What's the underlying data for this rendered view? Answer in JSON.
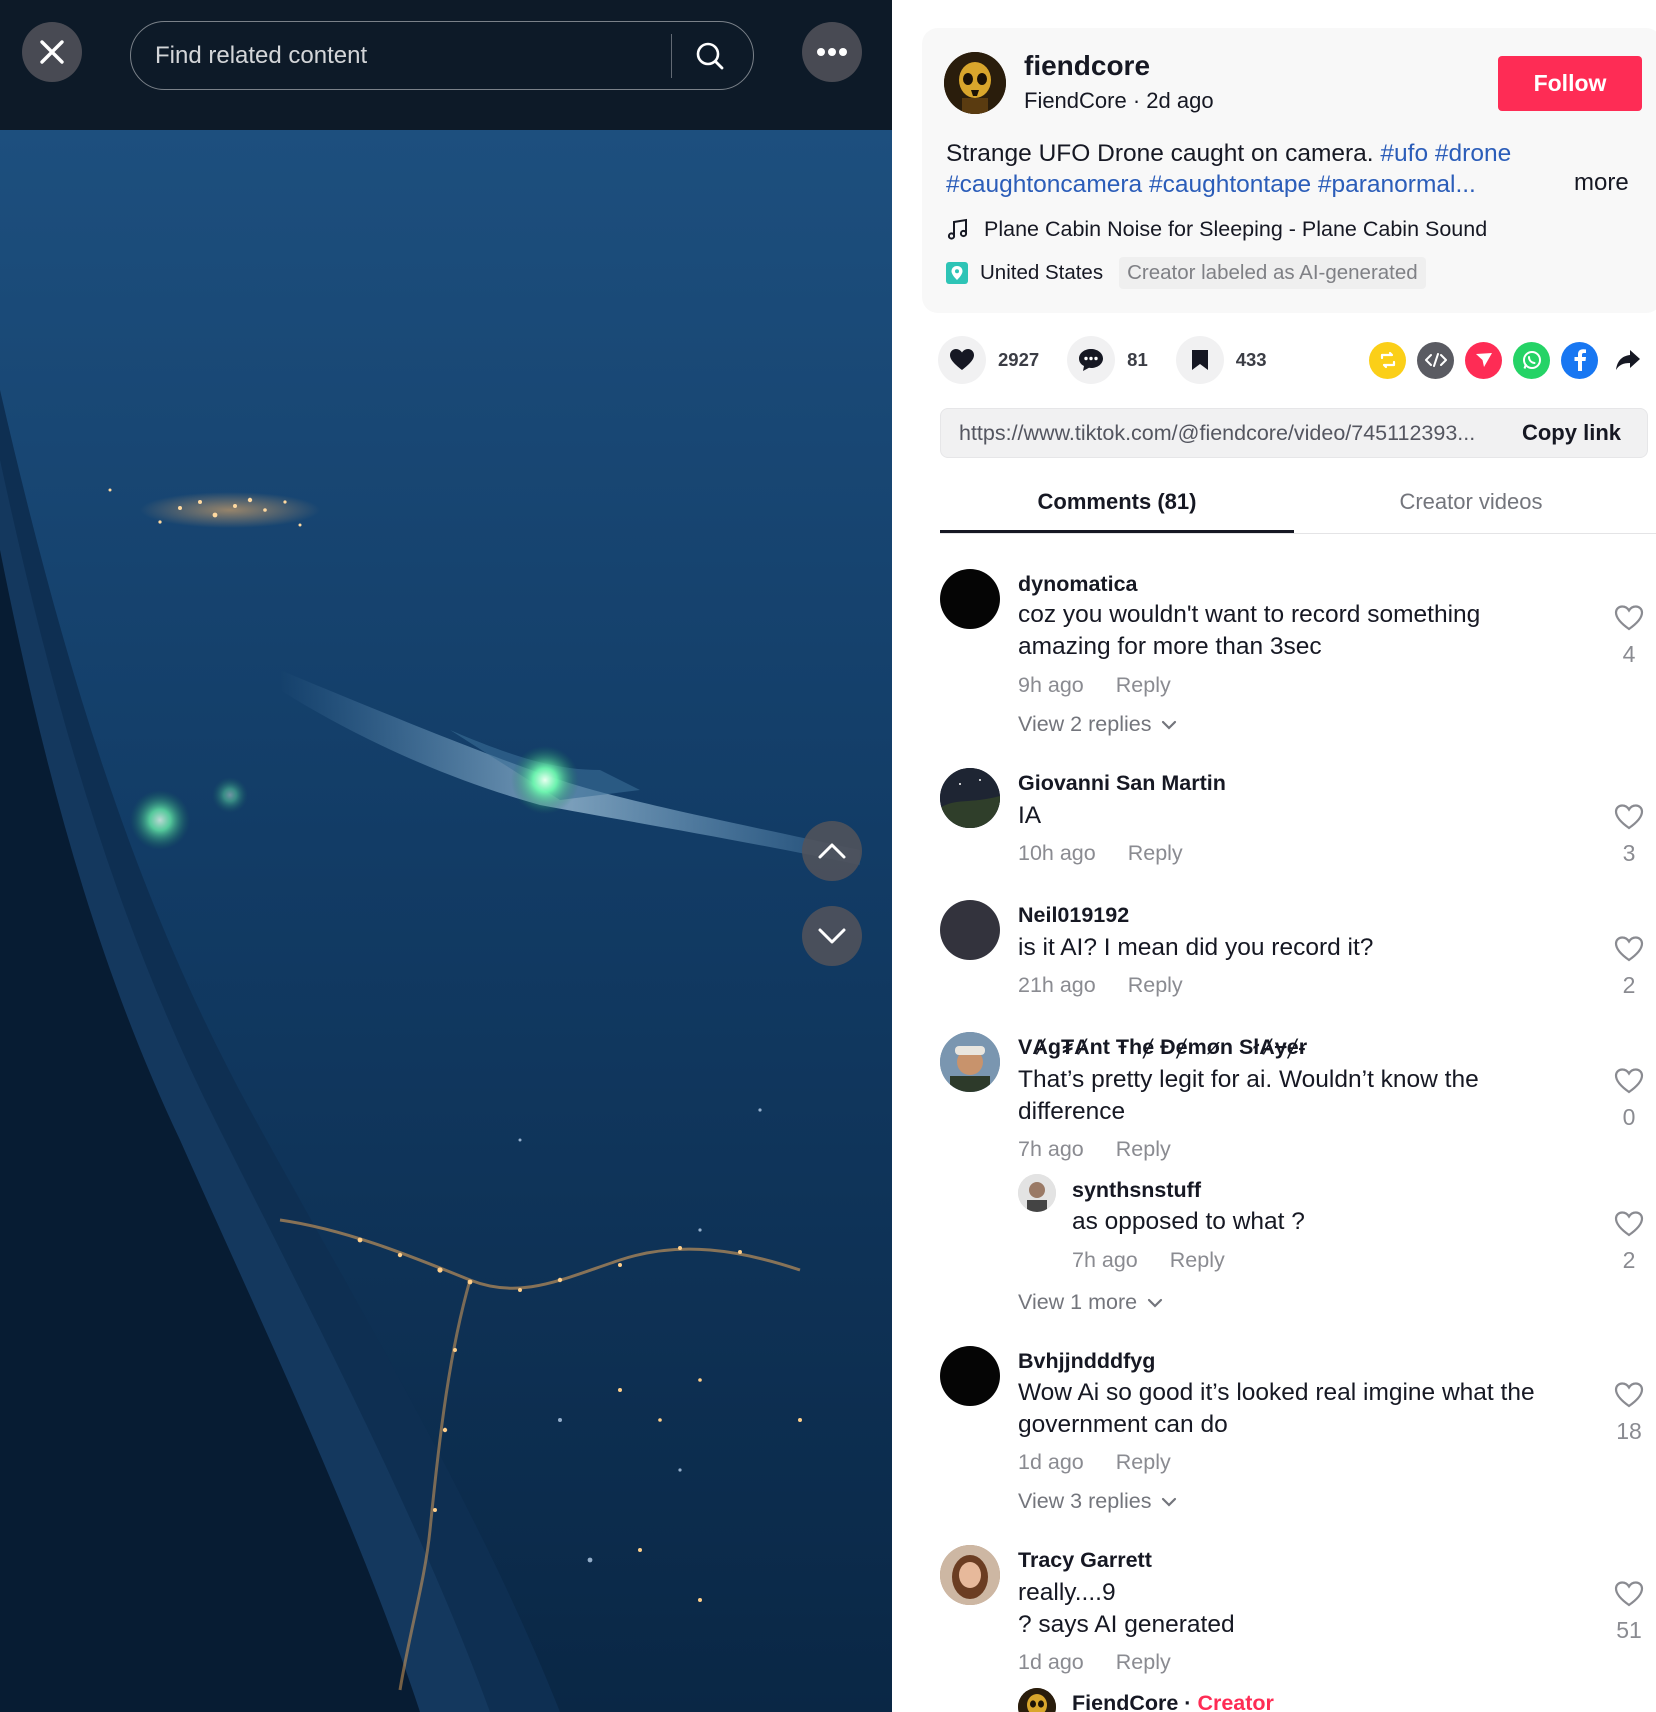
{
  "search": {
    "placeholder": "Find related content"
  },
  "post": {
    "handle": "fiendcore",
    "display_name": "FiendCore",
    "age": "2d ago",
    "follow_label": "Follow",
    "caption_text": "Strange UFO Drone caught on camera. ",
    "hashtags": [
      "#ufo",
      "#drone",
      "#caughtoncamera",
      "#caughtontape",
      "#paranormal..."
    ],
    "more_label": "more",
    "music": "Plane Cabin Noise for Sleeping - Plane Cabin Sound",
    "location": "United States",
    "ai_label": "Creator labeled as AI-generated"
  },
  "stats": {
    "likes": "2927",
    "comments": "81",
    "saves": "433"
  },
  "share_icons": [
    "repost-icon",
    "embed-icon",
    "send-icon",
    "whatsapp-icon",
    "facebook-icon",
    "share-arrow-icon"
  ],
  "link": {
    "url": "https://www.tiktok.com/@fiendcore/video/745112393...",
    "copy_label": "Copy link"
  },
  "tabs": [
    {
      "label": "Comments (81)"
    },
    {
      "label": "Creator videos"
    }
  ],
  "comments": [
    {
      "user": "dynomatica",
      "text": "coz you wouldn't want to record something amazing for more than 3sec",
      "time": "9h ago",
      "reply": "Reply",
      "likes": "4",
      "view": "View 2 replies"
    },
    {
      "user": "Giovanni San Martin",
      "text": "IA",
      "time": "10h ago",
      "reply": "Reply",
      "likes": "3"
    },
    {
      "user": "Neil019192",
      "text": "is it AI? I mean did you record it?",
      "time": "21h ago",
      "reply": "Reply",
      "likes": "2"
    },
    {
      "user": "VȺg₮Ⱥnt Ŧhɇ Đɇmøn SłȺɏɇɍ",
      "text": "That’s pretty legit for ai. Wouldn’t know the difference",
      "time": "7h ago",
      "reply": "Reply",
      "likes": "0",
      "view": "View 1 more",
      "replies": [
        {
          "user": "synthsnstuff",
          "text": "as opposed to what ?",
          "time": "7h ago",
          "reply": "Reply",
          "likes": "2"
        }
      ]
    },
    {
      "user": "Bvhjjndddfyg",
      "text": "Wow Ai so good it’s looked real imgine what the government can do",
      "time": "1d ago",
      "reply": "Reply",
      "likes": "18",
      "view": "View 3 replies"
    },
    {
      "user": "Tracy Garrett",
      "text": "really....9\n? says AI generated",
      "time": "1d ago",
      "reply": "Reply",
      "likes": "51",
      "replies": [
        {
          "user": "FiendCore",
          "creator_label": "Creator"
        }
      ]
    }
  ],
  "colors": {
    "accent": "#fe2c55",
    "hashtag": "#2b5db9",
    "muted": "#8a8b91"
  }
}
